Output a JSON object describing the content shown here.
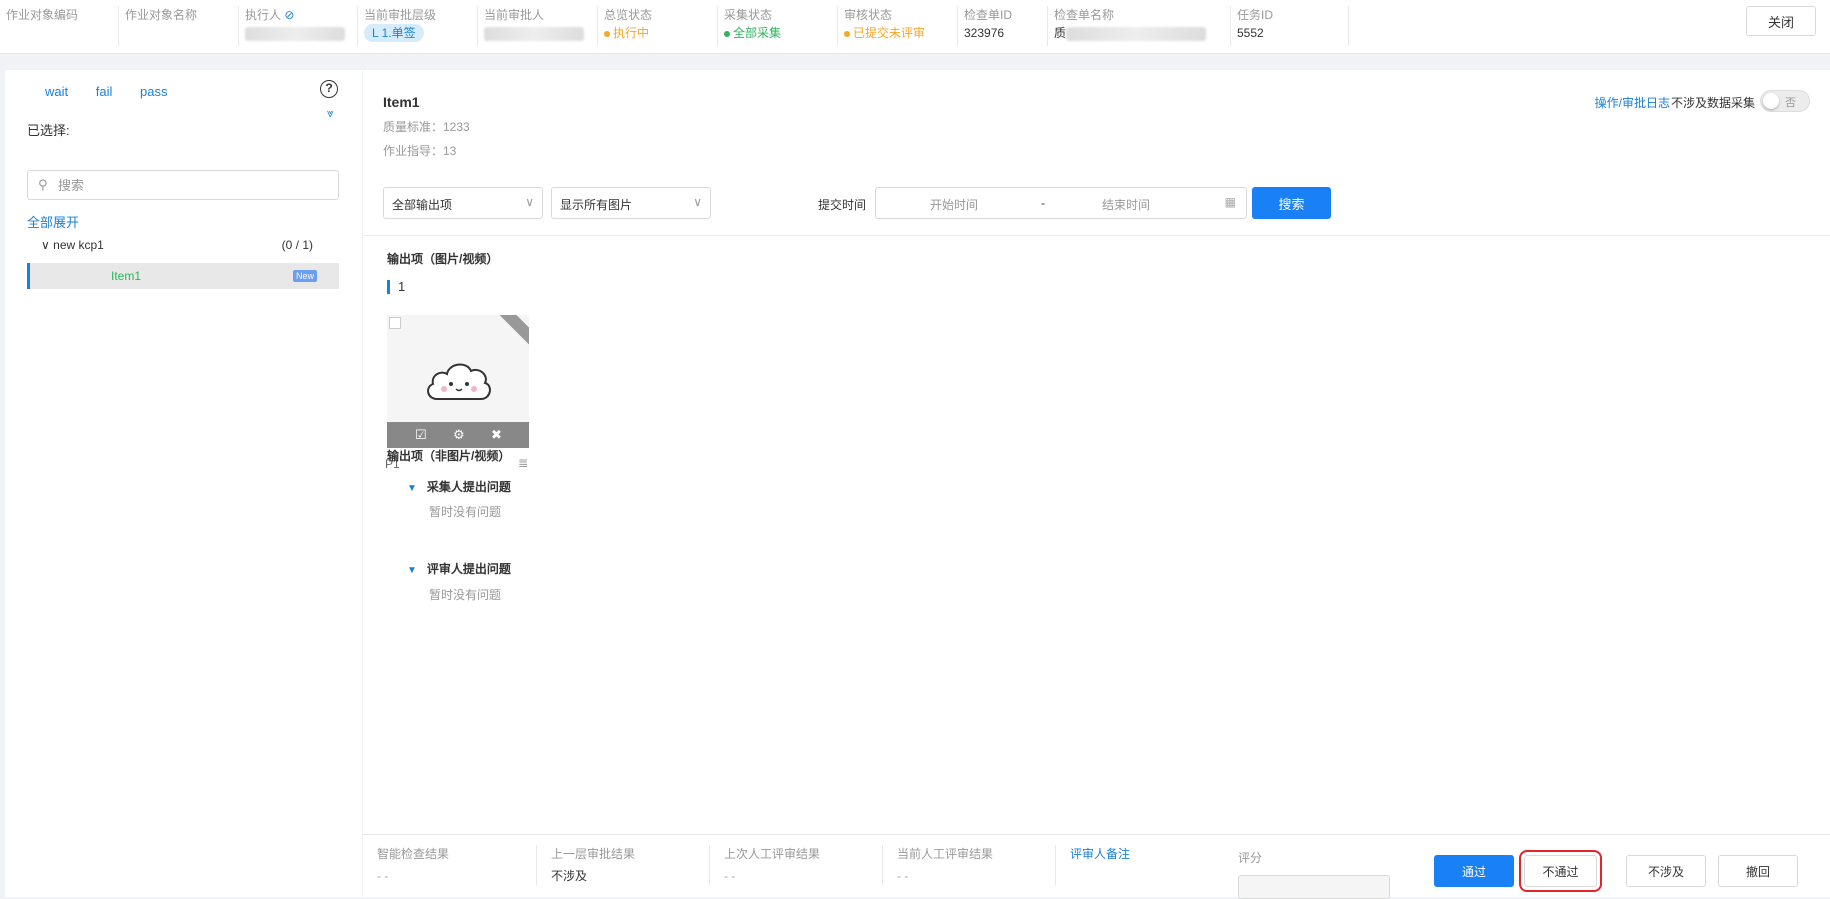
{
  "header": {
    "cols": [
      {
        "label": "作业对象编码",
        "value": ""
      },
      {
        "label": "作业对象名称",
        "value": ""
      },
      {
        "label": "执行人",
        "value": ""
      },
      {
        "label": "当前审批层级",
        "value": "L 1.单签"
      },
      {
        "label": "当前审批人",
        "value": ""
      },
      {
        "label": "总览状态",
        "value": "执行中"
      },
      {
        "label": "采集状态",
        "value": "全部采集"
      },
      {
        "label": "审核状态",
        "value": "已提交未评审"
      },
      {
        "label": "检查单ID",
        "value": "323976"
      },
      {
        "label": "检查单名称",
        "value": "质"
      },
      {
        "label": "任务ID",
        "value": "5552"
      }
    ],
    "close_label": "关闭",
    "colors": {
      "executing": "#f5a623",
      "collected": "#2db55d",
      "submitted": "#f5a623"
    }
  },
  "sidebar": {
    "filters": [
      "wait",
      "fail",
      "pass"
    ],
    "selected_label": "已选择:",
    "search_placeholder": "搜索",
    "expand_all": "全部展开",
    "tree": {
      "node_label": "new kcp1",
      "node_count": "(0 / 1)",
      "leaf_label": "Item1",
      "leaf_badge": "New"
    }
  },
  "main": {
    "title": "Item1",
    "quality_std": "质量标准：1233",
    "work_guide": "作业指导：13",
    "log_link": "操作/审批日志",
    "not_collect_label": "不涉及数据采集",
    "toggle_text": "否",
    "select_outputs": "全部输出项",
    "select_images": "显示所有图片",
    "submit_time_label": "提交时间",
    "start_placeholder": "开始时间",
    "range_dash": "-",
    "end_placeholder": "结束时间",
    "search_button": "搜索",
    "section_media": "输出项（图片/视频）",
    "group_number": "1",
    "thumb_caption": "P1",
    "section_nonmedia": "输出项（非图片/视频）",
    "collector_issues": "采集人提出问题",
    "collector_empty": "暂时没有问题",
    "reviewer_issues": "评审人提出问题",
    "reviewer_empty": "暂时没有问题"
  },
  "footer": {
    "cols": [
      {
        "label": "智能检查结果",
        "value": "- -"
      },
      {
        "label": "上一层审批结果",
        "value": "不涉及"
      },
      {
        "label": "上次人工评审结果",
        "value": "- -"
      },
      {
        "label": "当前人工评审结果",
        "value": "- -"
      },
      {
        "label": "评审人备注",
        "value": ""
      },
      {
        "label": "评分",
        "value": ""
      }
    ],
    "buttons": {
      "pass": "通过",
      "fail": "不通过",
      "na": "不涉及",
      "revoke": "撤回"
    }
  }
}
